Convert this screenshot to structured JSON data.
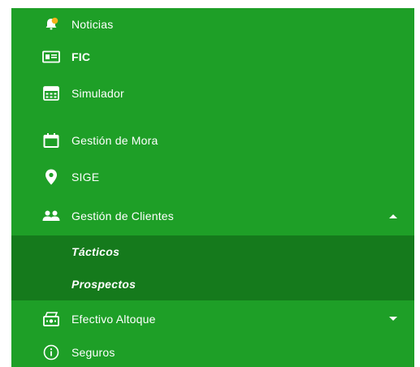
{
  "menu": {
    "items": [
      {
        "label": "Noticias",
        "icon": "notification-bell-icon"
      },
      {
        "label": "FIC",
        "icon": "id-card-icon"
      },
      {
        "label": "Simulador",
        "icon": "calculator-icon"
      },
      {
        "label": "Gestión de Mora",
        "icon": "calendar-icon"
      },
      {
        "label": "SIGE",
        "icon": "location-pin-icon"
      },
      {
        "label": "Gestión de Clientes",
        "icon": "people-icon",
        "expanded": true
      },
      {
        "label": "Efectivo Altoque",
        "icon": "cash-register-icon",
        "expanded": false
      },
      {
        "label": "Seguros",
        "icon": "info-icon"
      }
    ],
    "submenu": [
      {
        "label": "Tácticos"
      },
      {
        "label": "Prospectos"
      }
    ]
  },
  "colors": {
    "menu_bg": "#1e9f27",
    "submenu_bg": "#157a1c",
    "text": "#ffffff",
    "notification_dot": "#f5b21b"
  }
}
